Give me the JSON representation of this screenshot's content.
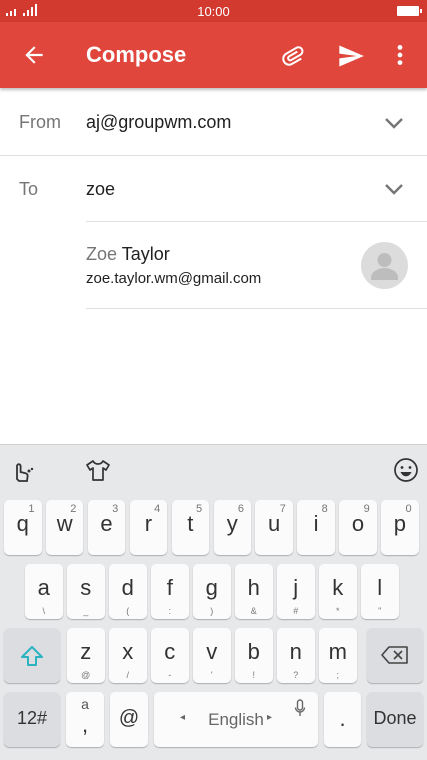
{
  "status_bar": {
    "time": "10:00"
  },
  "app_bar": {
    "title": "Compose"
  },
  "from_field": {
    "label": "From",
    "value": "aj@groupwm.com"
  },
  "to_field": {
    "label": "To",
    "value": "zoe"
  },
  "suggestion": {
    "name_match": "Zoe",
    "name_rest": " Taylor",
    "email": "zoe.taylor.wm@gmail.com"
  },
  "keyboard": {
    "row1": [
      {
        "key": "q",
        "num": "1"
      },
      {
        "key": "w",
        "num": "2"
      },
      {
        "key": "e",
        "num": "3"
      },
      {
        "key": "r",
        "num": "4"
      },
      {
        "key": "t",
        "num": "5"
      },
      {
        "key": "y",
        "num": "6"
      },
      {
        "key": "u",
        "num": "7"
      },
      {
        "key": "i",
        "num": "8"
      },
      {
        "key": "o",
        "num": "9"
      },
      {
        "key": "p",
        "num": "0"
      }
    ],
    "row2": [
      {
        "key": "a",
        "sub": "\\"
      },
      {
        "key": "s",
        "sub": "_"
      },
      {
        "key": "d",
        "sub": "("
      },
      {
        "key": "f",
        "sub": ":"
      },
      {
        "key": "g",
        "sub": ")"
      },
      {
        "key": "h",
        "sub": "&"
      },
      {
        "key": "j",
        "sub": "#"
      },
      {
        "key": "k",
        "sub": "*"
      },
      {
        "key": "l",
        "sub": "\""
      }
    ],
    "row3": [
      {
        "key": "z",
        "sub": "@"
      },
      {
        "key": "x",
        "sub": "/"
      },
      {
        "key": "c",
        "sub": "-"
      },
      {
        "key": "v",
        "sub": "'"
      },
      {
        "key": "b",
        "sub": "!"
      },
      {
        "key": "n",
        "sub": "?"
      },
      {
        "key": "m",
        "sub": ";"
      }
    ],
    "symbols_label": "12#",
    "comma_top": "a",
    "comma_label": ",",
    "at_label": "@",
    "space_label": "English",
    "period_label": ".",
    "done_label": "Done"
  }
}
